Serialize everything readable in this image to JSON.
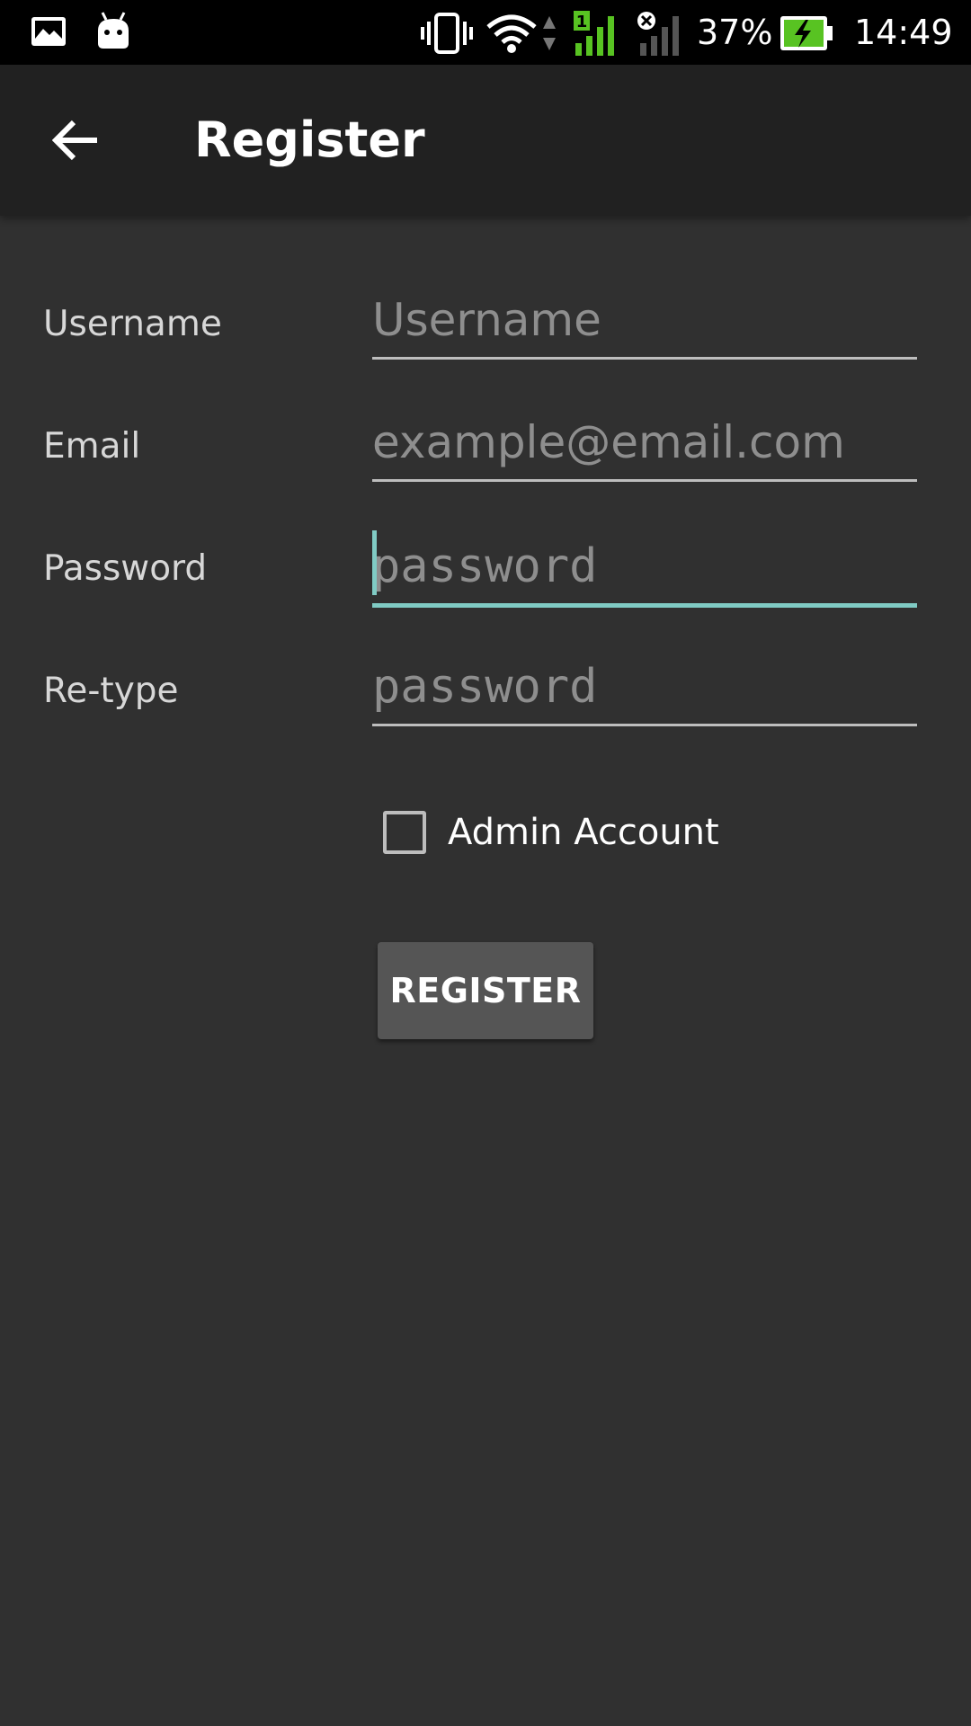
{
  "status_bar": {
    "icons": [
      "gallery-icon",
      "android-icon",
      "vibrate-icon",
      "wifi-icon",
      "data-arrows-icon",
      "signal-sim1-icon",
      "signal-no-sim-icon",
      "battery-charging-icon"
    ],
    "sim1_label": "1",
    "battery_percent": "37%",
    "time": "14:49",
    "colors": {
      "signal_active": "#58c322",
      "battery_fill": "#58c322"
    }
  },
  "app_bar": {
    "back_icon": "arrow-left-icon",
    "title": "Register"
  },
  "form": {
    "username": {
      "label": "Username",
      "value": "",
      "placeholder": "Username"
    },
    "email": {
      "label": "Email",
      "value": "",
      "placeholder": "example@email.com"
    },
    "password": {
      "label": "Password",
      "value": "",
      "placeholder": "password",
      "focused": true
    },
    "retype": {
      "label": "Re-type",
      "value": "",
      "placeholder": "password"
    },
    "admin_account": {
      "label": "Admin Account",
      "checked": false
    },
    "submit_label": "REGISTER"
  },
  "colors": {
    "background": "#303030",
    "app_bar": "#212121",
    "accent": "#80cbc4",
    "button": "#555555"
  }
}
